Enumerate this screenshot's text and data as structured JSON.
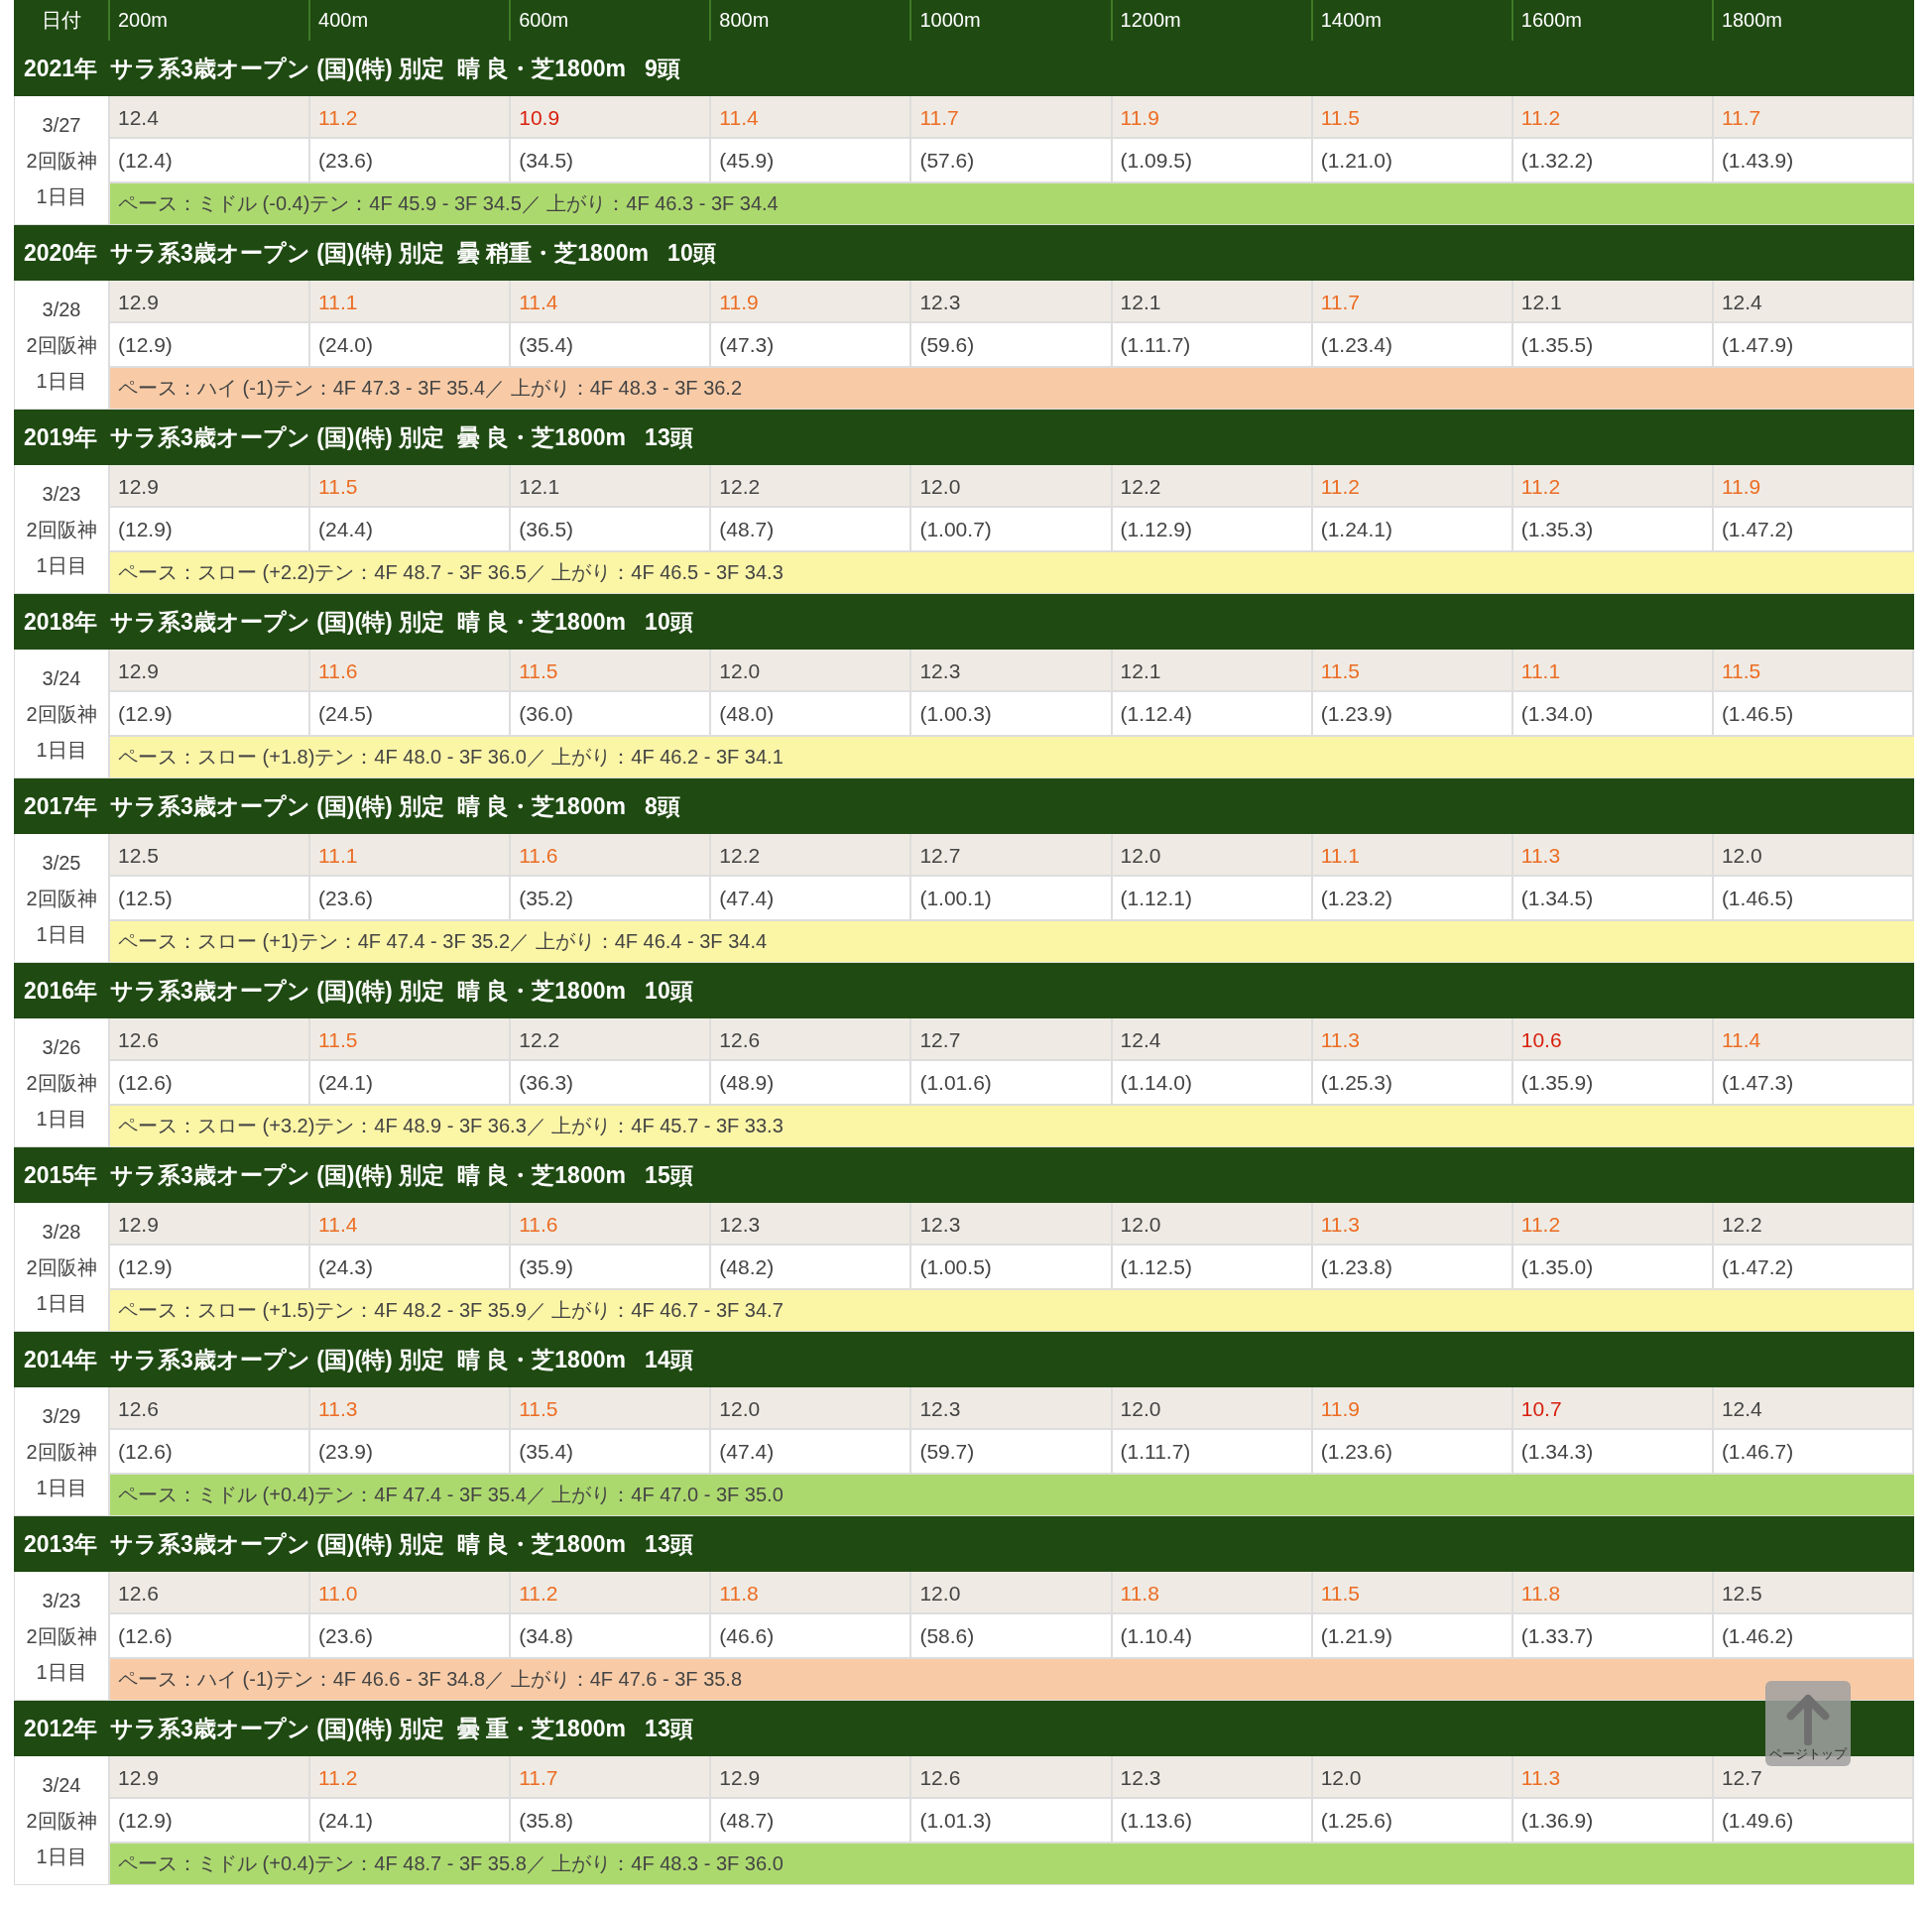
{
  "table": {
    "columns": [
      "日付",
      "200m",
      "400m",
      "600m",
      "800m",
      "1000m",
      "1200m",
      "1400m",
      "1600m",
      "1800m"
    ],
    "races": [
      {
        "title": "2021年  サラ系3歳オープン (国)(特) 別定  晴 良・芝1800m   9頭",
        "date": "3/27",
        "meeting": "2回阪神",
        "day": "1日目",
        "laps": [
          {
            "time": "12.4",
            "color": "#444444"
          },
          {
            "time": "11.2",
            "color": "#ec6d24"
          },
          {
            "time": "10.9",
            "color": "#d8200f"
          },
          {
            "time": "11.4",
            "color": "#ec6d24"
          },
          {
            "time": "11.7",
            "color": "#ec6d24"
          },
          {
            "time": "11.9",
            "color": "#ec6d24"
          },
          {
            "time": "11.5",
            "color": "#ec6d24"
          },
          {
            "time": "11.2",
            "color": "#ec6d24"
          },
          {
            "time": "11.7",
            "color": "#ec6d24"
          }
        ],
        "cumulative": [
          "(12.4)",
          "(23.6)",
          "(34.5)",
          "(45.9)",
          "(57.6)",
          "(1.09.5)",
          "(1.21.0)",
          "(1.32.2)",
          "(1.43.9)"
        ],
        "pace": {
          "kind": "middle",
          "text": "ペース：ミドル (-0.4)テン：4F 45.9 - 3F 34.5／ 上がり：4F 46.3 - 3F 34.4"
        }
      },
      {
        "title": "2020年  サラ系3歳オープン (国)(特) 別定  曇 稍重・芝1800m   10頭",
        "date": "3/28",
        "meeting": "2回阪神",
        "day": "1日目",
        "laps": [
          {
            "time": "12.9",
            "color": "#444444"
          },
          {
            "time": "11.1",
            "color": "#ec6d24"
          },
          {
            "time": "11.4",
            "color": "#ec6d24"
          },
          {
            "time": "11.9",
            "color": "#ec6d24"
          },
          {
            "time": "12.3",
            "color": "#444444"
          },
          {
            "time": "12.1",
            "color": "#444444"
          },
          {
            "time": "11.7",
            "color": "#ec6d24"
          },
          {
            "time": "12.1",
            "color": "#444444"
          },
          {
            "time": "12.4",
            "color": "#444444"
          }
        ],
        "cumulative": [
          "(12.9)",
          "(24.0)",
          "(35.4)",
          "(47.3)",
          "(59.6)",
          "(1.11.7)",
          "(1.23.4)",
          "(1.35.5)",
          "(1.47.9)"
        ],
        "pace": {
          "kind": "high",
          "text": "ペース：ハイ (-1)テン：4F 47.3 - 3F 35.4／ 上がり：4F 48.3 - 3F 36.2"
        }
      },
      {
        "title": "2019年  サラ系3歳オープン (国)(特) 別定  曇 良・芝1800m   13頭",
        "date": "3/23",
        "meeting": "2回阪神",
        "day": "1日目",
        "laps": [
          {
            "time": "12.9",
            "color": "#444444"
          },
          {
            "time": "11.5",
            "color": "#ec6d24"
          },
          {
            "time": "12.1",
            "color": "#444444"
          },
          {
            "time": "12.2",
            "color": "#444444"
          },
          {
            "time": "12.0",
            "color": "#444444"
          },
          {
            "time": "12.2",
            "color": "#444444"
          },
          {
            "time": "11.2",
            "color": "#ec6d24"
          },
          {
            "time": "11.2",
            "color": "#ec6d24"
          },
          {
            "time": "11.9",
            "color": "#ec6d24"
          }
        ],
        "cumulative": [
          "(12.9)",
          "(24.4)",
          "(36.5)",
          "(48.7)",
          "(1.00.7)",
          "(1.12.9)",
          "(1.24.1)",
          "(1.35.3)",
          "(1.47.2)"
        ],
        "pace": {
          "kind": "slow",
          "text": "ペース：スロー (+2.2)テン：4F 48.7 - 3F 36.5／ 上がり：4F 46.5 - 3F 34.3"
        }
      },
      {
        "title": "2018年  サラ系3歳オープン (国)(特) 別定  晴 良・芝1800m   10頭",
        "date": "3/24",
        "meeting": "2回阪神",
        "day": "1日目",
        "laps": [
          {
            "time": "12.9",
            "color": "#444444"
          },
          {
            "time": "11.6",
            "color": "#ec6d24"
          },
          {
            "time": "11.5",
            "color": "#ec6d24"
          },
          {
            "time": "12.0",
            "color": "#444444"
          },
          {
            "time": "12.3",
            "color": "#444444"
          },
          {
            "time": "12.1",
            "color": "#444444"
          },
          {
            "time": "11.5",
            "color": "#ec6d24"
          },
          {
            "time": "11.1",
            "color": "#ec6d24"
          },
          {
            "time": "11.5",
            "color": "#ec6d24"
          }
        ],
        "cumulative": [
          "(12.9)",
          "(24.5)",
          "(36.0)",
          "(48.0)",
          "(1.00.3)",
          "(1.12.4)",
          "(1.23.9)",
          "(1.34.0)",
          "(1.46.5)"
        ],
        "pace": {
          "kind": "slow",
          "text": "ペース：スロー (+1.8)テン：4F 48.0 - 3F 36.0／ 上がり：4F 46.2 - 3F 34.1"
        }
      },
      {
        "title": "2017年  サラ系3歳オープン (国)(特) 別定  晴 良・芝1800m   8頭",
        "date": "3/25",
        "meeting": "2回阪神",
        "day": "1日目",
        "laps": [
          {
            "time": "12.5",
            "color": "#444444"
          },
          {
            "time": "11.1",
            "color": "#ec6d24"
          },
          {
            "time": "11.6",
            "color": "#ec6d24"
          },
          {
            "time": "12.2",
            "color": "#444444"
          },
          {
            "time": "12.7",
            "color": "#444444"
          },
          {
            "time": "12.0",
            "color": "#444444"
          },
          {
            "time": "11.1",
            "color": "#ec6d24"
          },
          {
            "time": "11.3",
            "color": "#ec6d24"
          },
          {
            "time": "12.0",
            "color": "#444444"
          }
        ],
        "cumulative": [
          "(12.5)",
          "(23.6)",
          "(35.2)",
          "(47.4)",
          "(1.00.1)",
          "(1.12.1)",
          "(1.23.2)",
          "(1.34.5)",
          "(1.46.5)"
        ],
        "pace": {
          "kind": "slow",
          "text": "ペース：スロー (+1)テン：4F 47.4 - 3F 35.2／ 上がり：4F 46.4 - 3F 34.4"
        }
      },
      {
        "title": "2016年  サラ系3歳オープン (国)(特) 別定  晴 良・芝1800m   10頭",
        "date": "3/26",
        "meeting": "2回阪神",
        "day": "1日目",
        "laps": [
          {
            "time": "12.6",
            "color": "#444444"
          },
          {
            "time": "11.5",
            "color": "#ec6d24"
          },
          {
            "time": "12.2",
            "color": "#444444"
          },
          {
            "time": "12.6",
            "color": "#444444"
          },
          {
            "time": "12.7",
            "color": "#444444"
          },
          {
            "time": "12.4",
            "color": "#444444"
          },
          {
            "time": "11.3",
            "color": "#ec6d24"
          },
          {
            "time": "10.6",
            "color": "#d8200f"
          },
          {
            "time": "11.4",
            "color": "#ec6d24"
          }
        ],
        "cumulative": [
          "(12.6)",
          "(24.1)",
          "(36.3)",
          "(48.9)",
          "(1.01.6)",
          "(1.14.0)",
          "(1.25.3)",
          "(1.35.9)",
          "(1.47.3)"
        ],
        "pace": {
          "kind": "slow",
          "text": "ペース：スロー (+3.2)テン：4F 48.9 - 3F 36.3／ 上がり：4F 45.7 - 3F 33.3"
        }
      },
      {
        "title": "2015年  サラ系3歳オープン (国)(特) 別定  晴 良・芝1800m   15頭",
        "date": "3/28",
        "meeting": "2回阪神",
        "day": "1日目",
        "laps": [
          {
            "time": "12.9",
            "color": "#444444"
          },
          {
            "time": "11.4",
            "color": "#ec6d24"
          },
          {
            "time": "11.6",
            "color": "#ec6d24"
          },
          {
            "time": "12.3",
            "color": "#444444"
          },
          {
            "time": "12.3",
            "color": "#444444"
          },
          {
            "time": "12.0",
            "color": "#444444"
          },
          {
            "time": "11.3",
            "color": "#ec6d24"
          },
          {
            "time": "11.2",
            "color": "#ec6d24"
          },
          {
            "time": "12.2",
            "color": "#444444"
          }
        ],
        "cumulative": [
          "(12.9)",
          "(24.3)",
          "(35.9)",
          "(48.2)",
          "(1.00.5)",
          "(1.12.5)",
          "(1.23.8)",
          "(1.35.0)",
          "(1.47.2)"
        ],
        "pace": {
          "kind": "slow",
          "text": "ペース：スロー (+1.5)テン：4F 48.2 - 3F 35.9／ 上がり：4F 46.7 - 3F 34.7"
        }
      },
      {
        "title": "2014年  サラ系3歳オープン (国)(特) 別定  晴 良・芝1800m   14頭",
        "date": "3/29",
        "meeting": "2回阪神",
        "day": "1日目",
        "laps": [
          {
            "time": "12.6",
            "color": "#444444"
          },
          {
            "time": "11.3",
            "color": "#ec6d24"
          },
          {
            "time": "11.5",
            "color": "#ec6d24"
          },
          {
            "time": "12.0",
            "color": "#444444"
          },
          {
            "time": "12.3",
            "color": "#444444"
          },
          {
            "time": "12.0",
            "color": "#444444"
          },
          {
            "time": "11.9",
            "color": "#ec6d24"
          },
          {
            "time": "10.7",
            "color": "#d8200f"
          },
          {
            "time": "12.4",
            "color": "#444444"
          }
        ],
        "cumulative": [
          "(12.6)",
          "(23.9)",
          "(35.4)",
          "(47.4)",
          "(59.7)",
          "(1.11.7)",
          "(1.23.6)",
          "(1.34.3)",
          "(1.46.7)"
        ],
        "pace": {
          "kind": "middle",
          "text": "ペース：ミドル (+0.4)テン：4F 47.4 - 3F 35.4／ 上がり：4F 47.0 - 3F 35.0"
        }
      },
      {
        "title": "2013年  サラ系3歳オープン (国)(特) 別定  晴 良・芝1800m   13頭",
        "date": "3/23",
        "meeting": "2回阪神",
        "day": "1日目",
        "laps": [
          {
            "time": "12.6",
            "color": "#444444"
          },
          {
            "time": "11.0",
            "color": "#ec6d24"
          },
          {
            "time": "11.2",
            "color": "#ec6d24"
          },
          {
            "time": "11.8",
            "color": "#ec6d24"
          },
          {
            "time": "12.0",
            "color": "#444444"
          },
          {
            "time": "11.8",
            "color": "#ec6d24"
          },
          {
            "time": "11.5",
            "color": "#ec6d24"
          },
          {
            "time": "11.8",
            "color": "#ec6d24"
          },
          {
            "time": "12.5",
            "color": "#444444"
          }
        ],
        "cumulative": [
          "(12.6)",
          "(23.6)",
          "(34.8)",
          "(46.6)",
          "(58.6)",
          "(1.10.4)",
          "(1.21.9)",
          "(1.33.7)",
          "(1.46.2)"
        ],
        "pace": {
          "kind": "high",
          "text": "ペース：ハイ (-1)テン：4F 46.6 - 3F 34.8／ 上がり：4F 47.6 - 3F 35.8"
        }
      },
      {
        "title": "2012年  サラ系3歳オープン (国)(特) 別定  曇 重・芝1800m   13頭",
        "date": "3/24",
        "meeting": "2回阪神",
        "day": "1日目",
        "laps": [
          {
            "time": "12.9",
            "color": "#444444"
          },
          {
            "time": "11.2",
            "color": "#ec6d24"
          },
          {
            "time": "11.7",
            "color": "#ec6d24"
          },
          {
            "time": "12.9",
            "color": "#444444"
          },
          {
            "time": "12.6",
            "color": "#444444"
          },
          {
            "time": "12.3",
            "color": "#444444"
          },
          {
            "time": "12.0",
            "color": "#444444"
          },
          {
            "time": "11.3",
            "color": "#ec6d24"
          },
          {
            "time": "12.7",
            "color": "#444444"
          }
        ],
        "cumulative": [
          "(12.9)",
          "(24.1)",
          "(35.8)",
          "(48.7)",
          "(1.01.3)",
          "(1.13.6)",
          "(1.25.6)",
          "(1.36.9)",
          "(1.49.6)"
        ],
        "pace": {
          "kind": "middle",
          "text": "ペース：ミドル (+0.4)テン：4F 48.7 - 3F 35.8／ 上がり：4F 48.3 - 3F 36.0"
        }
      }
    ]
  },
  "page_top_button": {
    "label": "ページトップ"
  }
}
